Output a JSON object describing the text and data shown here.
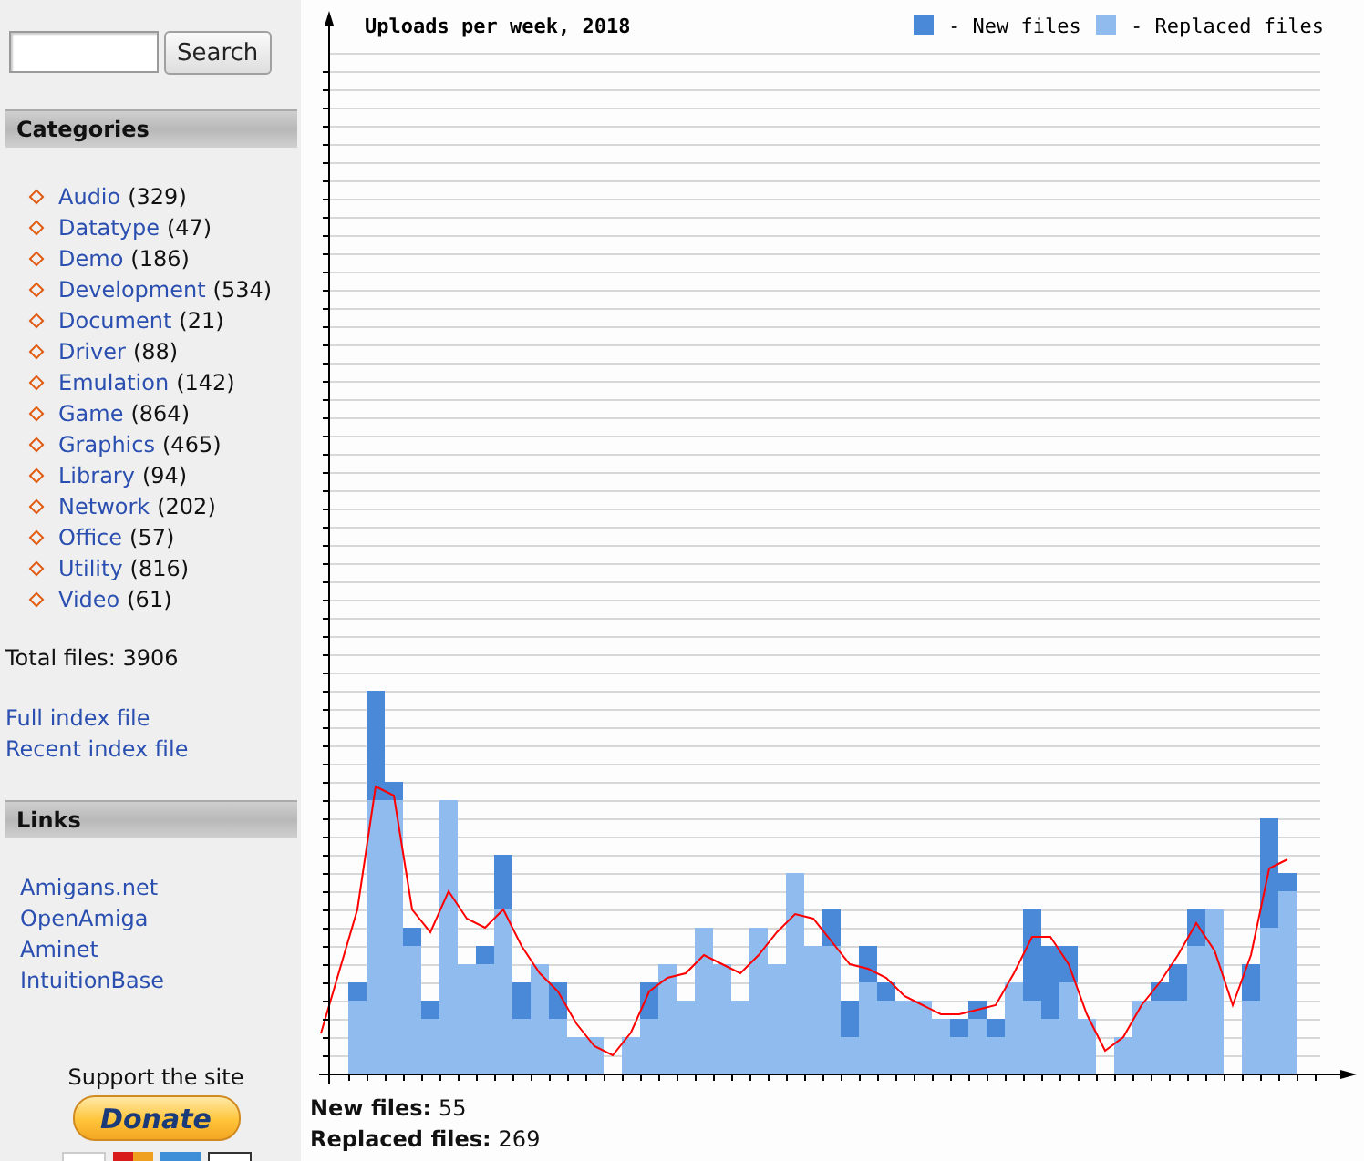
{
  "search": {
    "button": "Search"
  },
  "categories": {
    "title": "Categories",
    "items": [
      {
        "name": "Audio",
        "count": "(329)"
      },
      {
        "name": "Datatype",
        "count": "(47)"
      },
      {
        "name": "Demo",
        "count": "(186)"
      },
      {
        "name": "Development",
        "count": "(534)"
      },
      {
        "name": "Document",
        "count": "(21)"
      },
      {
        "name": "Driver",
        "count": "(88)"
      },
      {
        "name": "Emulation",
        "count": "(142)"
      },
      {
        "name": "Game",
        "count": "(864)"
      },
      {
        "name": "Graphics",
        "count": "(465)"
      },
      {
        "name": "Library",
        "count": "(94)"
      },
      {
        "name": "Network",
        "count": "(202)"
      },
      {
        "name": "Office",
        "count": "(57)"
      },
      {
        "name": "Utility",
        "count": "(816)"
      },
      {
        "name": "Video",
        "count": "(61)"
      }
    ]
  },
  "total": "Total files: 3906",
  "index_links": [
    "Full index file",
    "Recent index file"
  ],
  "links": {
    "title": "Links",
    "items": [
      "Amigans.net",
      "OpenAmiga",
      "Aminet",
      "IntuitionBase"
    ]
  },
  "support": {
    "text": "Support the site",
    "donate": "Donate"
  },
  "chart": {
    "title": "Uploads per week, 2018",
    "legend": [
      {
        "label": "- New files",
        "color": "#4a88d8"
      },
      {
        "label": "- Replaced files",
        "color": "#8fbbee"
      }
    ]
  },
  "stats": [
    {
      "label": "New files:",
      "value": "55"
    },
    {
      "label": "Replaced files:",
      "value": "269"
    }
  ]
}
